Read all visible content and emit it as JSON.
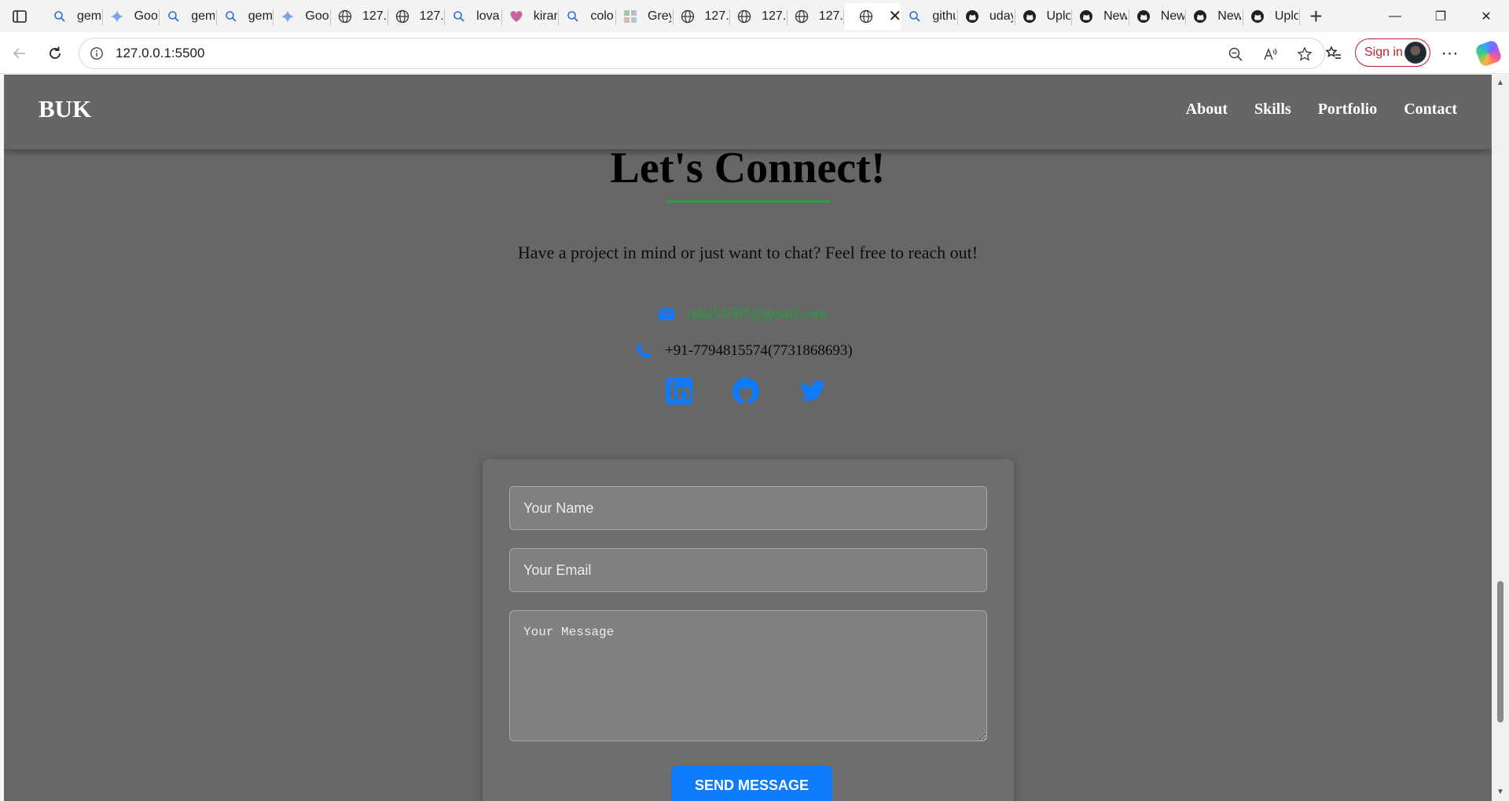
{
  "browser": {
    "tabs": [
      {
        "title": "gem",
        "icon": "search-icon"
      },
      {
        "title": "Goo",
        "icon": "sparkle-icon"
      },
      {
        "title": "gem",
        "icon": "search-icon"
      },
      {
        "title": "gem",
        "icon": "search-icon"
      },
      {
        "title": "Goo",
        "icon": "sparkle-icon"
      },
      {
        "title": "127.",
        "icon": "globe-icon"
      },
      {
        "title": "127.",
        "icon": "globe-icon"
      },
      {
        "title": "lova",
        "icon": "search-icon"
      },
      {
        "title": "kirar",
        "icon": "heart-icon"
      },
      {
        "title": "colo",
        "icon": "search-icon"
      },
      {
        "title": "Grey",
        "icon": "palette-icon"
      },
      {
        "title": "127.",
        "icon": "globe-icon"
      },
      {
        "title": "127.",
        "icon": "globe-icon"
      },
      {
        "title": "127.",
        "icon": "globe-icon"
      },
      {
        "title": "",
        "icon": "globe-icon",
        "active": true
      },
      {
        "title": "githu",
        "icon": "search-icon"
      },
      {
        "title": "uday",
        "icon": "github-icon"
      },
      {
        "title": "Uplo",
        "icon": "github-icon"
      },
      {
        "title": "New",
        "icon": "github-icon"
      },
      {
        "title": "New",
        "icon": "github-icon"
      },
      {
        "title": "New",
        "icon": "github-icon"
      },
      {
        "title": "Uplo",
        "icon": "github-icon"
      }
    ],
    "url": "127.0.0.1:5500",
    "sign_in_label": "Sign in",
    "accent": "#b4232a"
  },
  "site": {
    "brand": "BUK",
    "nav": [
      "About",
      "Skills",
      "Portfolio",
      "Contact"
    ]
  },
  "contact": {
    "heading": "Let's Connect!",
    "intro": "Have a project in mind or just want to chat? Feel free to reach out!",
    "email": "udai54587@gmail.com",
    "phone": "+91-7794815574(7731868693)",
    "socials": [
      "linkedin-icon",
      "github-icon",
      "twitter-icon"
    ],
    "form": {
      "name_placeholder": "Your Name",
      "email_placeholder": "Your Email",
      "message_placeholder": "Your Message",
      "submit_label": "SEND MESSAGE"
    }
  },
  "colors": {
    "page_bg": "#676767",
    "accent_green": "#20a33a",
    "icon_blue": "#0d7bfe"
  }
}
